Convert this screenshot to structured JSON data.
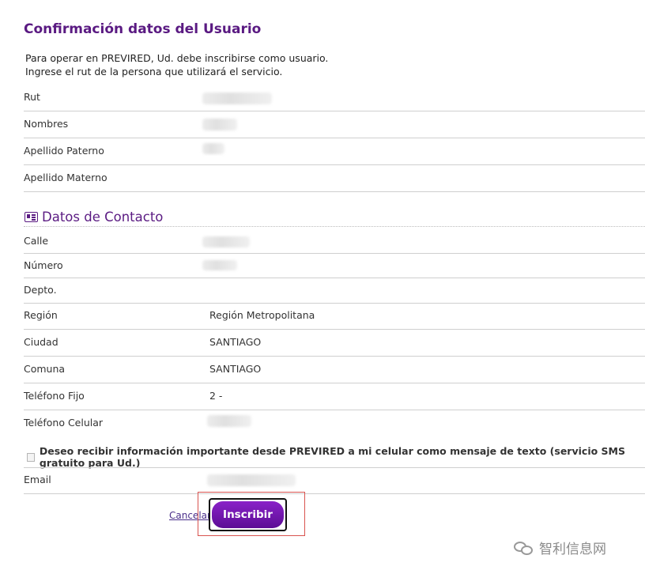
{
  "header": {
    "title": "Confirmación datos del Usuario"
  },
  "intro": {
    "line1": "Para operar en PREVIRED, Ud. debe inscribirse como usuario.",
    "line2": "Ingrese el rut de la persona que utilizará el servicio."
  },
  "user_fields": [
    {
      "label": "Rut",
      "value": ""
    },
    {
      "label": "Nombres",
      "value": ""
    },
    {
      "label": "Apellido Paterno",
      "value": ""
    },
    {
      "label": "Apellido Materno",
      "value": ""
    }
  ],
  "contact": {
    "title": "Datos de Contacto",
    "icon": "contact-card-icon",
    "fields": [
      {
        "label": "Calle",
        "value": ""
      },
      {
        "label": "Número",
        "value": ""
      },
      {
        "label": "Depto.",
        "value": ""
      },
      {
        "label": "Región",
        "value": "Región Metropolitana"
      },
      {
        "label": "Ciudad",
        "value": "SANTIAGO"
      },
      {
        "label": "Comuna",
        "value": "SANTIAGO"
      },
      {
        "label": "Teléfono Fijo",
        "value": "2 -"
      },
      {
        "label": "Teléfono Celular",
        "value": ""
      }
    ],
    "sms_optin": "Deseo recibir información importante desde PREVIRED a mi celular como mensaje de texto (servicio SMS gratuito para Ud.)",
    "sms_checked": false,
    "email_label": "Email",
    "email_value": ""
  },
  "actions": {
    "cancel": "Cancelar",
    "submit": "Inscribir"
  },
  "watermark": {
    "text": "智利信息网",
    "icon": "wechat-icon"
  },
  "colors": {
    "accent": "#5a1a82",
    "button": "#6a10a8",
    "divider": "#cfcfcf"
  }
}
